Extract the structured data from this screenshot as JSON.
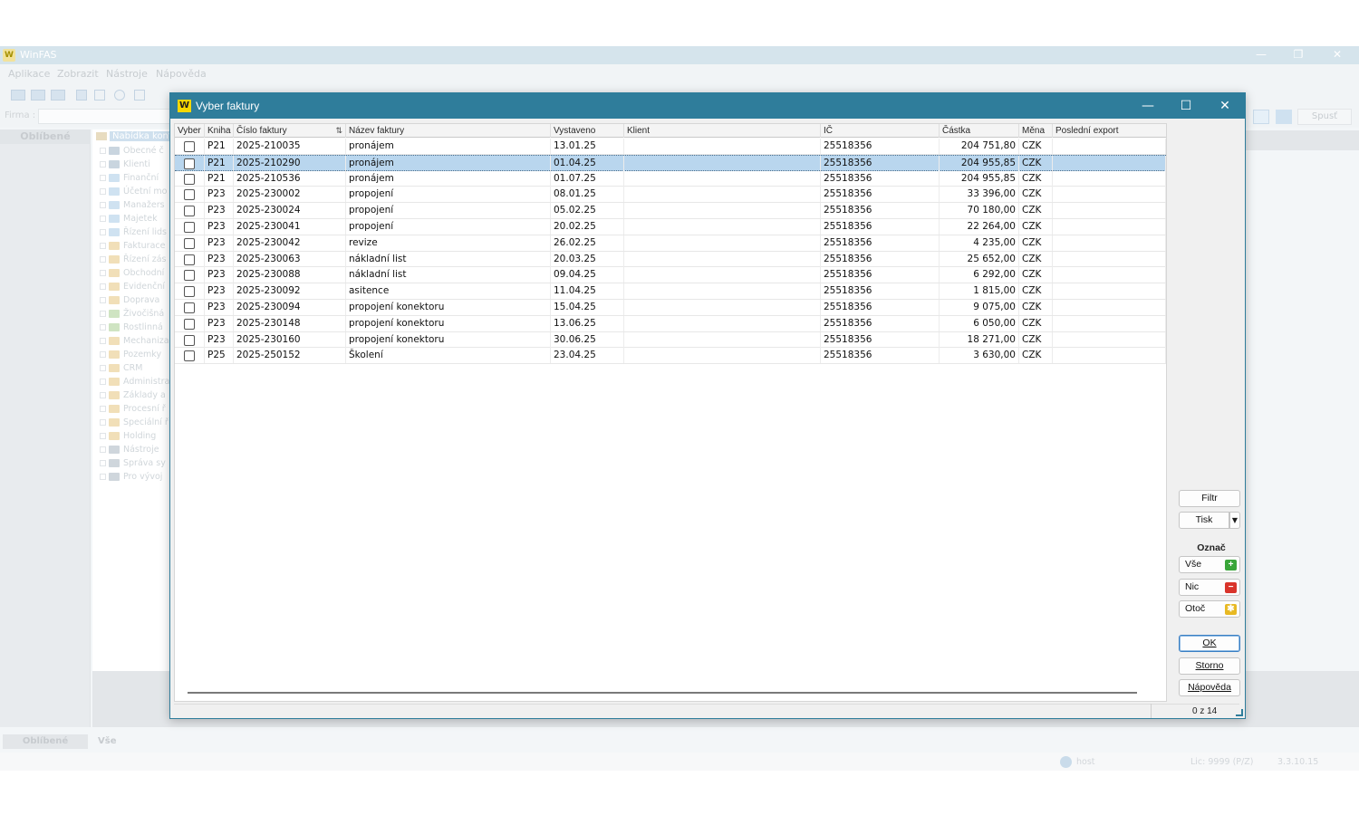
{
  "app": {
    "title": "WinFAS",
    "menu": [
      "Aplikace",
      "Zobrazit",
      "Nástroje",
      "Nápověda"
    ],
    "firma_label": "Firma :",
    "spust_label": "Spusť",
    "sidebar_title": "Oblíbené",
    "tree_root": "Nabídka konfig",
    "tree_items": [
      "Obecné č",
      "Klienti",
      "Finanční",
      "Účetní mo",
      "Manažers",
      "Majetek",
      "Řízení lids",
      "Fakturace",
      "Řízení zás",
      "Obchodní",
      "Evidenční",
      "Doprava",
      "Živočišná",
      "Rostlinná",
      "Mechaniza",
      "Pozemky",
      "CRM",
      "Administra",
      "Základy a",
      "Procesní ř",
      "Speciální ř",
      "Holding",
      "Nástroje",
      "Správa sy",
      "Pro vývoj"
    ],
    "tabs": {
      "favorites": "Oblíbené",
      "all": "Vše"
    },
    "status": {
      "user": "host",
      "license": "Lic: 9999 (P/Z)",
      "version": "3.3.10.15"
    },
    "window_controls": {
      "minimize": "—",
      "restore": "❐",
      "close": "✕"
    }
  },
  "dialog": {
    "title": "Vyber faktury",
    "logo_text": "W",
    "controls": {
      "minimize": "—",
      "maximize": "☐",
      "close": "✕"
    },
    "columns": {
      "vyber": "Vyber",
      "kniha": "Kniha",
      "cislo": "Číslo faktury",
      "nazev": "Název faktury",
      "vystaveno": "Vystaveno",
      "klient": "Klient",
      "ic": "IČ",
      "castka": "Částka",
      "mena": "Měna",
      "export": "Poslední export"
    },
    "rows": [
      {
        "kniha": "P21",
        "cislo": "2025-210035",
        "nazev": "pronájem",
        "vystaveno": "13.01.25",
        "klient": "",
        "ic": "25518356",
        "castka": "204 751,80",
        "mena": "CZK",
        "export": "",
        "checked": false,
        "selected": false
      },
      {
        "kniha": "P21",
        "cislo": "2025-210290",
        "nazev": "pronájem",
        "vystaveno": "01.04.25",
        "klient": "",
        "ic": "25518356",
        "castka": "204 955,85",
        "mena": "CZK",
        "export": "",
        "checked": false,
        "selected": true
      },
      {
        "kniha": "P21",
        "cislo": "2025-210536",
        "nazev": "pronájem",
        "vystaveno": "01.07.25",
        "klient": "",
        "ic": "25518356",
        "castka": "204 955,85",
        "mena": "CZK",
        "export": "",
        "checked": false,
        "selected": false
      },
      {
        "kniha": "P23",
        "cislo": "2025-230002",
        "nazev": "propojení",
        "vystaveno": "08.01.25",
        "klient": "",
        "ic": "25518356",
        "castka": "33 396,00",
        "mena": "CZK",
        "export": "",
        "checked": false,
        "selected": false
      },
      {
        "kniha": "P23",
        "cislo": "2025-230024",
        "nazev": "propojení",
        "vystaveno": "05.02.25",
        "klient": "",
        "ic": "25518356",
        "castka": "70 180,00",
        "mena": "CZK",
        "export": "",
        "checked": false,
        "selected": false
      },
      {
        "kniha": "P23",
        "cislo": "2025-230041",
        "nazev": "propojení",
        "vystaveno": "20.02.25",
        "klient": "",
        "ic": "25518356",
        "castka": "22 264,00",
        "mena": "CZK",
        "export": "",
        "checked": false,
        "selected": false
      },
      {
        "kniha": "P23",
        "cislo": "2025-230042",
        "nazev": "revize",
        "vystaveno": "26.02.25",
        "klient": "",
        "ic": "25518356",
        "castka": "4 235,00",
        "mena": "CZK",
        "export": "",
        "checked": false,
        "selected": false
      },
      {
        "kniha": "P23",
        "cislo": "2025-230063",
        "nazev": "nákladní list",
        "vystaveno": "20.03.25",
        "klient": "",
        "ic": "25518356",
        "castka": "25 652,00",
        "mena": "CZK",
        "export": "",
        "checked": false,
        "selected": false
      },
      {
        "kniha": "P23",
        "cislo": "2025-230088",
        "nazev": "nákladní list",
        "vystaveno": "09.04.25",
        "klient": "",
        "ic": "25518356",
        "castka": "6 292,00",
        "mena": "CZK",
        "export": "",
        "checked": false,
        "selected": false
      },
      {
        "kniha": "P23",
        "cislo": "2025-230092",
        "nazev": "asitence",
        "vystaveno": "11.04.25",
        "klient": "",
        "ic": "25518356",
        "castka": "1 815,00",
        "mena": "CZK",
        "export": "",
        "checked": false,
        "selected": false
      },
      {
        "kniha": "P23",
        "cislo": "2025-230094",
        "nazev": "propojení konektoru",
        "vystaveno": "15.04.25",
        "klient": "",
        "ic": "25518356",
        "castka": "9 075,00",
        "mena": "CZK",
        "export": "",
        "checked": false,
        "selected": false
      },
      {
        "kniha": "P23",
        "cislo": "2025-230148",
        "nazev": "propojení konektoru",
        "vystaveno": "13.06.25",
        "klient": "",
        "ic": "25518356",
        "castka": "6 050,00",
        "mena": "CZK",
        "export": "",
        "checked": false,
        "selected": false
      },
      {
        "kniha": "P23",
        "cislo": "2025-230160",
        "nazev": "propojení konektoru",
        "vystaveno": "30.06.25",
        "klient": "",
        "ic": "25518356",
        "castka": "18 271,00",
        "mena": "CZK",
        "export": "",
        "checked": false,
        "selected": false
      },
      {
        "kniha": "P25",
        "cislo": "2025-250152",
        "nazev": "Školení",
        "vystaveno": "23.04.25",
        "klient": "",
        "ic": "25518356",
        "castka": "3 630,00",
        "mena": "CZK",
        "export": "",
        "checked": false,
        "selected": false
      }
    ],
    "buttons": {
      "filtr": "Filtr",
      "tisk": "Tisk",
      "tisk_arrow": "▼",
      "oznac_label": "Označ",
      "vse": "Vše",
      "vse_icon": "+",
      "nic": "Nic",
      "nic_icon": "−",
      "otoc": "Otoč",
      "otoc_icon": "✱",
      "ok": "OK",
      "storno": "Storno",
      "napoveda": "Nápověda"
    },
    "count": "0 z 14"
  },
  "colors": {
    "dialog_title": "#2f7d9b",
    "selected_row": "#b9d6ee",
    "add_green": "#3aa63a",
    "remove_red": "#d9342b",
    "invert_yellow": "#e8b923"
  },
  "icons": {
    "sort_indicator": "sort-icon",
    "add": "plus-icon",
    "remove": "minus-icon",
    "invert": "invert-icon"
  }
}
